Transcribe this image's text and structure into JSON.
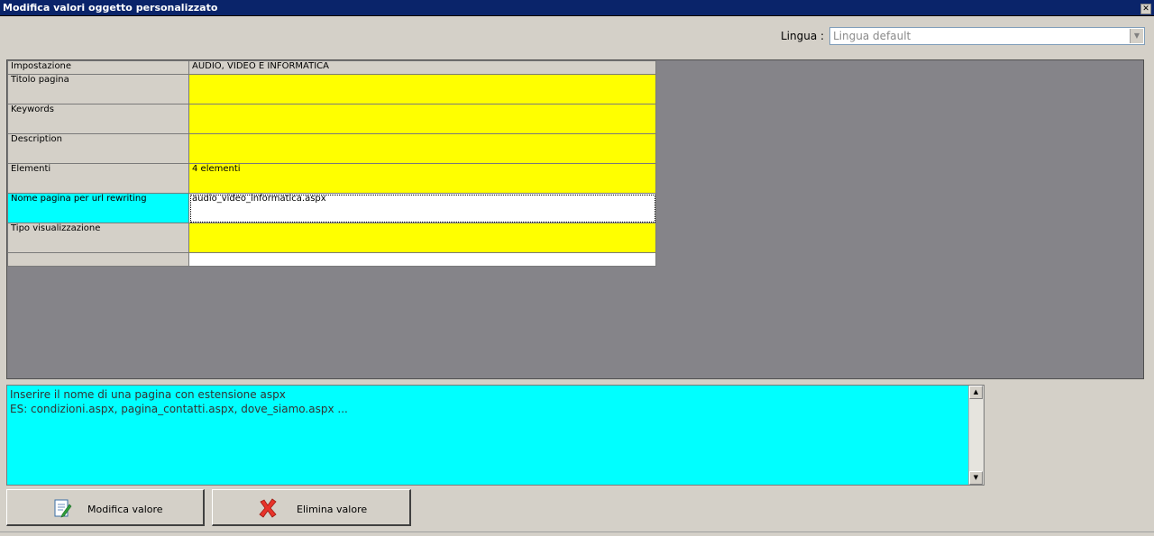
{
  "window": {
    "title": "Modifica valori oggetto personalizzato"
  },
  "language": {
    "label": "Lingua :",
    "selected": "Lingua default"
  },
  "properties": {
    "header": {
      "key": "Impostazione",
      "value": "AUDIO, VIDEO E INFORMATICA"
    },
    "rows": [
      {
        "key": "Titolo pagina",
        "value": ""
      },
      {
        "key": "Keywords",
        "value": ""
      },
      {
        "key": "Description",
        "value": ""
      },
      {
        "key": "Elementi",
        "value": "4 elementi"
      },
      {
        "key": "Nome pagina per url rewriting",
        "value": "audio_video_informatica.aspx"
      },
      {
        "key": "Tipo visualizzazione",
        "value": ""
      }
    ]
  },
  "help": {
    "line1": "Inserire il nome di una pagina con estensione aspx",
    "line2": "ES: condizioni.aspx, pagina_contatti.aspx, dove_siamo.aspx ..."
  },
  "buttons": {
    "edit_label": "Modifica valore",
    "delete_label": "Elimina valore"
  },
  "colors": {
    "titlebar": "#0a246a",
    "required": "#ffff00",
    "selected": "#00ffff",
    "background": "#d4d0c8"
  },
  "icons": {
    "edit": "edit-document-icon",
    "delete": "red-x-icon",
    "close": "close-icon"
  }
}
